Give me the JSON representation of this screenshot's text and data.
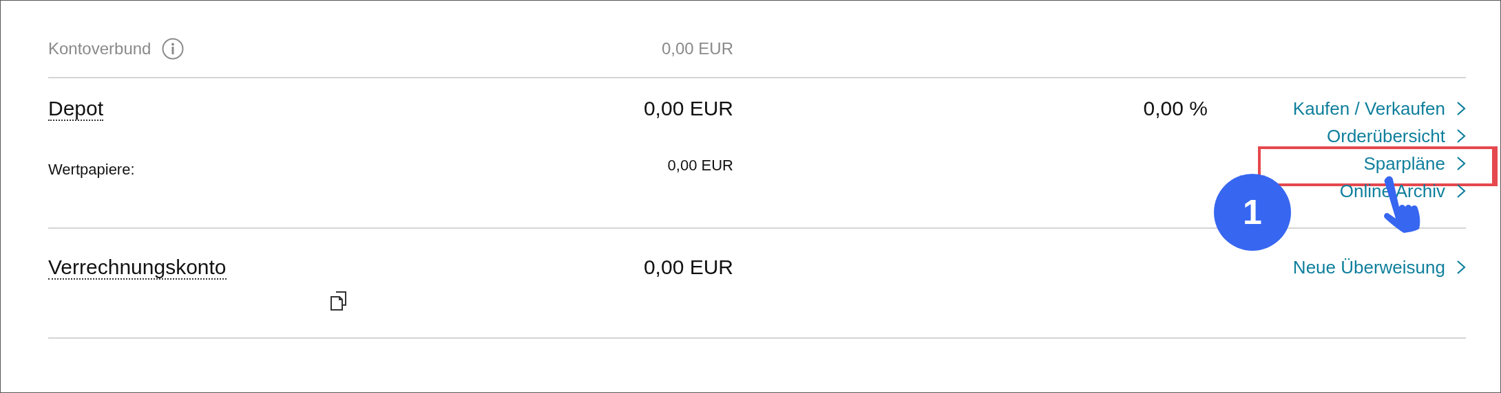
{
  "summary": {
    "label": "Kontoverbund",
    "amount": "0,00 EUR"
  },
  "accounts": [
    {
      "kind": "depot",
      "name": "Depot",
      "amount": "0,00 EUR",
      "percent": "0,00 %",
      "sub": {
        "label": "Wertpapiere:",
        "amount": "0,00 EUR"
      },
      "copy": false,
      "links": [
        {
          "label": "Kaufen / Verkaufen",
          "highlighted": false
        },
        {
          "label": "Orderübersicht",
          "highlighted": false
        },
        {
          "label": "Sparpläne",
          "highlighted": true
        },
        {
          "label": "Online Archiv",
          "highlighted": false
        }
      ]
    },
    {
      "kind": "cash",
      "name": "Verrechnungskonto",
      "amount": "0,00 EUR",
      "copy": true,
      "links": [
        {
          "label": "Neue Überweisung",
          "highlighted": false
        }
      ]
    }
  ],
  "annotation": {
    "step": "1"
  }
}
